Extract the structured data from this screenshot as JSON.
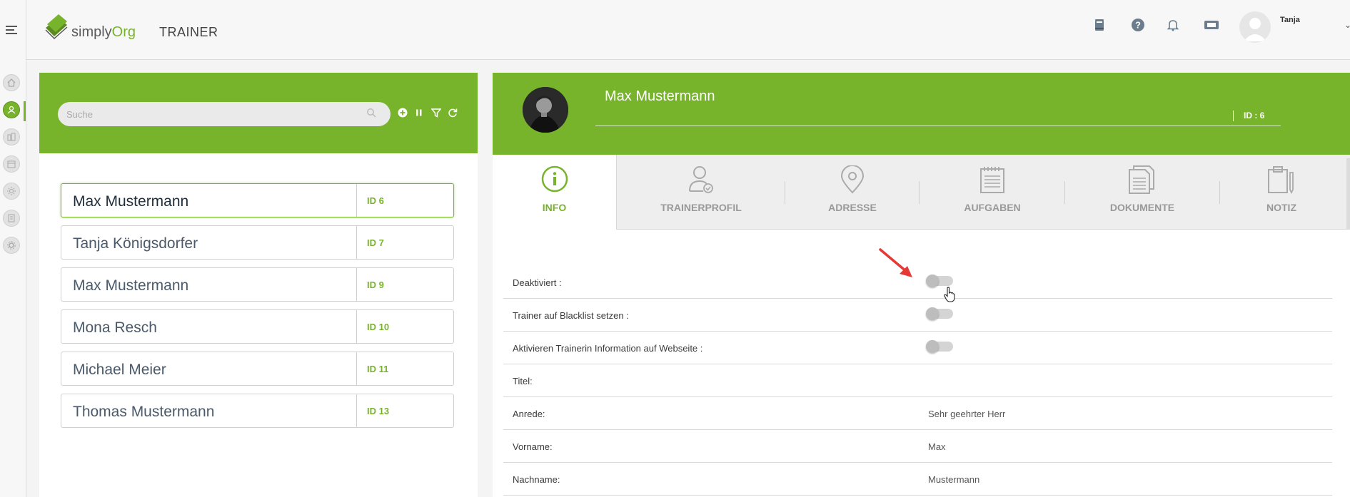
{
  "header": {
    "logo_simply": "simply",
    "logo_org": "Org",
    "section": "TRAINER",
    "user_name": "Tanja"
  },
  "colors": {
    "brand_green": "#77b32b",
    "pointer_arrow": "#e53935"
  },
  "sidebar": {
    "icons": [
      "home-icon",
      "trainer-icon",
      "building-icon",
      "calendar-icon",
      "sun-icon",
      "document-icon",
      "settings-icon"
    ],
    "active": "trainer-icon"
  },
  "list_panel": {
    "search_placeholder": "Suche",
    "toolbar": [
      "add-icon",
      "pause-icon",
      "filter-icon",
      "refresh-icon"
    ],
    "items": [
      {
        "name": "Max Mustermann",
        "id": "ID 6",
        "selected": true
      },
      {
        "name": "Tanja Königsdorfer",
        "id": "ID 7"
      },
      {
        "name": "Max Mustermann",
        "id": "ID 9"
      },
      {
        "name": "Mona Resch",
        "id": "ID 10"
      },
      {
        "name": "Michael Meier",
        "id": "ID 11"
      },
      {
        "name": "Thomas Mustermann",
        "id": "ID 13"
      }
    ]
  },
  "detail": {
    "name": "Max Mustermann",
    "id_text": "ID : 6",
    "tabs": [
      {
        "label": "INFO",
        "icon": "info-icon",
        "active": true
      },
      {
        "label": "TRAINERPROFIL",
        "icon": "trainer-profile-icon"
      },
      {
        "label": "ADRESSE",
        "icon": "location-pin-icon"
      },
      {
        "label": "AUFGABEN",
        "icon": "notepad-icon"
      },
      {
        "label": "DOKUMENTE",
        "icon": "documents-icon"
      },
      {
        "label": "NOTIZ",
        "icon": "clipboard-pen-icon"
      }
    ],
    "fields": [
      {
        "label": "Deaktiviert :",
        "type": "toggle",
        "value": false
      },
      {
        "label": "Trainer auf Blacklist setzen :",
        "type": "toggle",
        "value": false
      },
      {
        "label": "Aktivieren Trainerin Information auf Webseite :",
        "type": "toggle",
        "value": false
      },
      {
        "label": "Titel:",
        "type": "text",
        "value": ""
      },
      {
        "label": "Anrede:",
        "type": "text",
        "value": "Sehr geehrter Herr"
      },
      {
        "label": "Vorname:",
        "type": "text",
        "value": "Max"
      },
      {
        "label": "Nachname:",
        "type": "text",
        "value": "Mustermann"
      }
    ]
  }
}
